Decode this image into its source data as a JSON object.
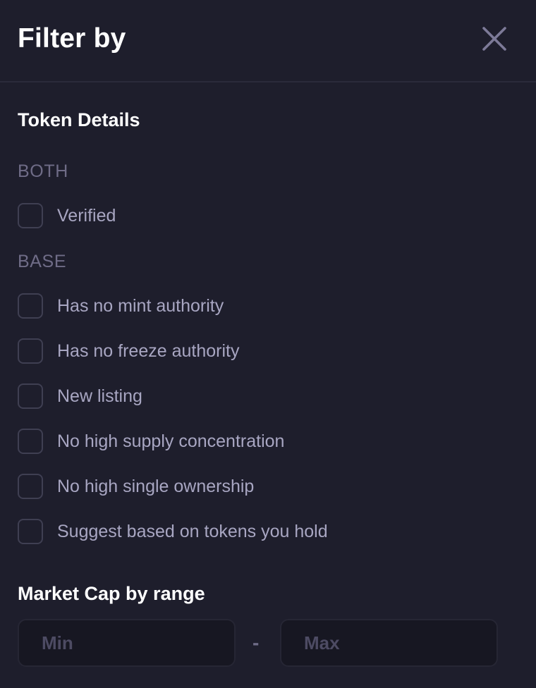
{
  "header": {
    "title": "Filter by",
    "close_icon": "close-icon"
  },
  "token_details": {
    "title": "Token Details",
    "groups": [
      {
        "label": "BOTH",
        "options": [
          {
            "label": "Verified",
            "checked": false
          }
        ]
      },
      {
        "label": "BASE",
        "options": [
          {
            "label": "Has no mint authority",
            "checked": false
          },
          {
            "label": "Has no freeze authority",
            "checked": false
          },
          {
            "label": "New listing",
            "checked": false
          },
          {
            "label": "No high supply concentration",
            "checked": false
          },
          {
            "label": "No high single ownership",
            "checked": false
          },
          {
            "label": "Suggest based on tokens you hold",
            "checked": false
          }
        ]
      }
    ]
  },
  "market_cap": {
    "title": "Market Cap by range",
    "min_placeholder": "Min",
    "max_placeholder": "Max",
    "separator": "-"
  },
  "colors": {
    "background": "#1e1e2c",
    "heading": "#ffffff",
    "group_label": "#6f6c87",
    "option_label": "#a8a6c2",
    "checkbox_border": "#3f3f52",
    "input_background": "#171722"
  }
}
